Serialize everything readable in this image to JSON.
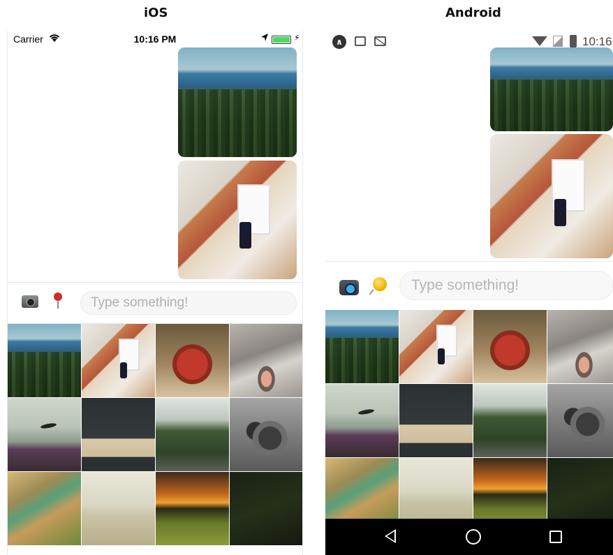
{
  "titles": {
    "ios": "iOS",
    "android": "Android"
  },
  "ios": {
    "status": {
      "carrier": "Carrier",
      "time": "10:16 PM"
    },
    "input_placeholder": "Type something!",
    "messages": [
      "forest",
      "desk"
    ],
    "grid": [
      "forest",
      "desk",
      "mug",
      "cat",
      "bird",
      "keyboard",
      "trees",
      "pinecone",
      "grass",
      "beach",
      "sunset",
      "night"
    ]
  },
  "android": {
    "status": {
      "time": "10:16"
    },
    "input_placeholder": "Type something!",
    "messages": [
      "forest",
      "desk"
    ],
    "grid": [
      "forest",
      "desk",
      "mug",
      "cat",
      "bird",
      "keyboard",
      "trees",
      "pinecone",
      "grass",
      "beach",
      "sunset",
      "night"
    ]
  },
  "icons": {
    "camera": "camera-icon",
    "location": "location-pin-icon",
    "wifi": "wifi-icon",
    "battery": "battery-icon",
    "back": "back-icon",
    "home": "home-icon",
    "recents": "recents-icon"
  }
}
